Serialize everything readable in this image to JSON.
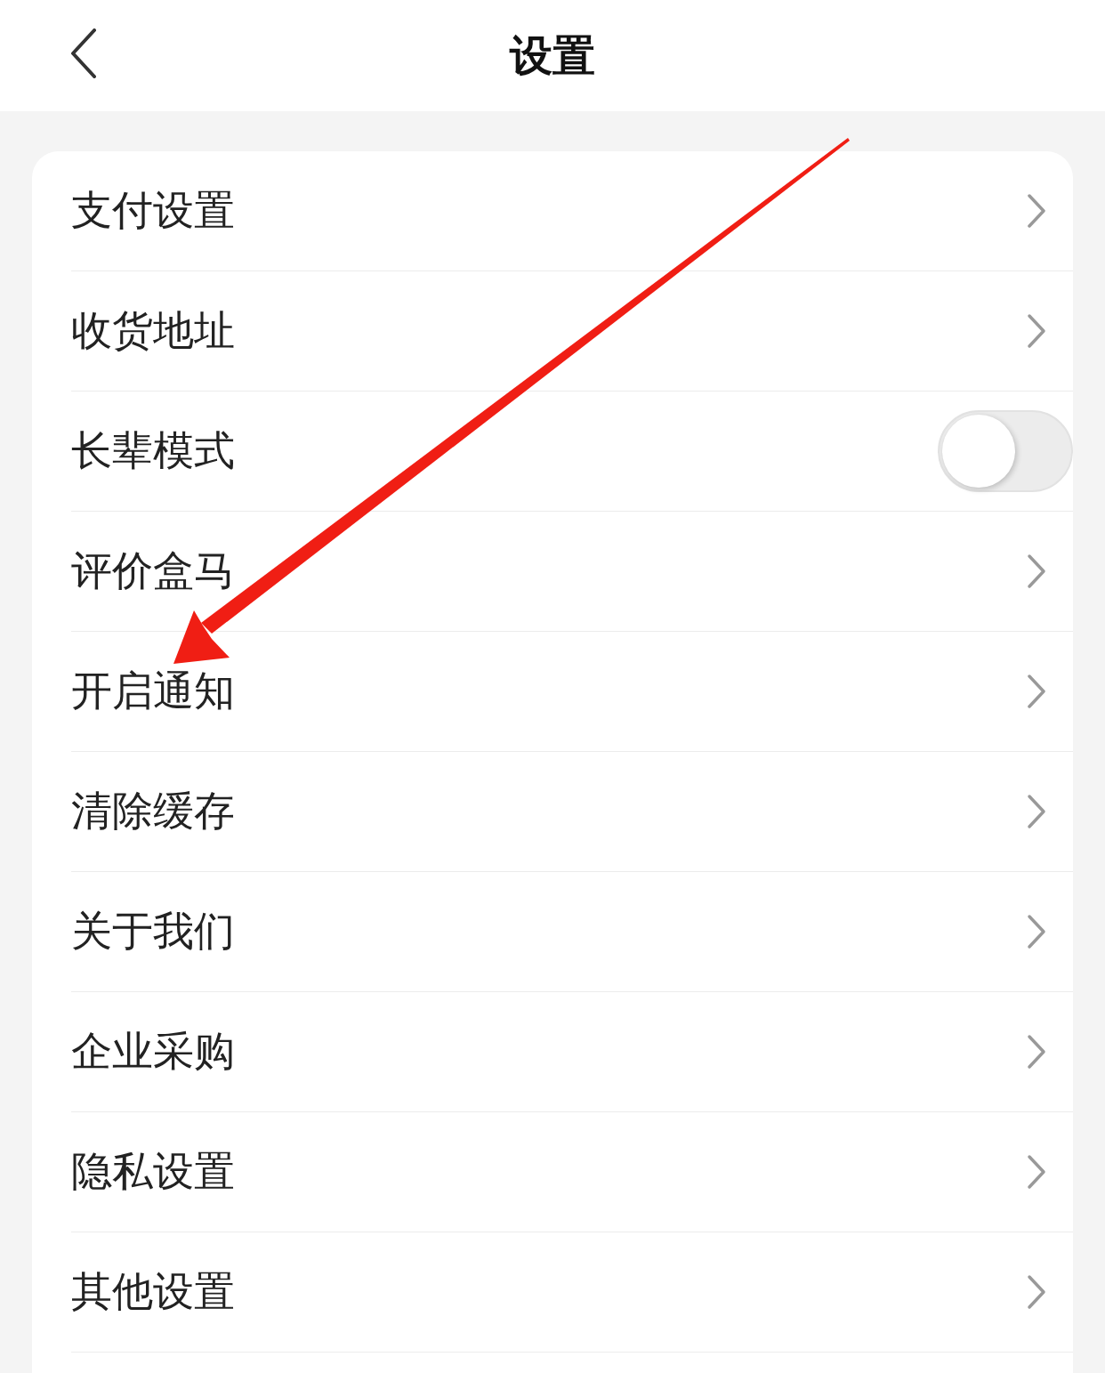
{
  "header": {
    "title": "设置"
  },
  "rows": [
    {
      "kind": "link",
      "label": "支付设置"
    },
    {
      "kind": "link",
      "label": "收货地址"
    },
    {
      "kind": "toggle",
      "label": "长辈模式",
      "on": false
    },
    {
      "kind": "link",
      "label": "评价盒马"
    },
    {
      "kind": "link",
      "label": "开启通知"
    },
    {
      "kind": "link",
      "label": "清除缓存"
    },
    {
      "kind": "link",
      "label": "关于我们"
    },
    {
      "kind": "link",
      "label": "企业采购"
    },
    {
      "kind": "link",
      "label": "隐私设置"
    },
    {
      "kind": "link",
      "label": "其他设置"
    }
  ]
}
